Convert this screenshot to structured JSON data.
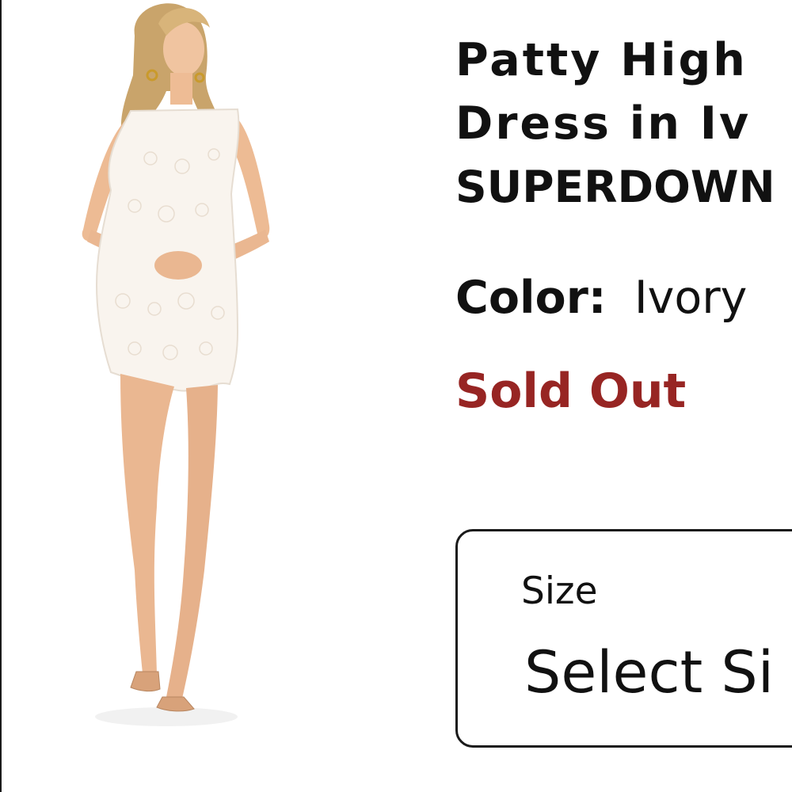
{
  "product": {
    "title_lines": [
      "Patty High",
      "Dress in Iv",
      "SUPERDOWN"
    ],
    "color_label": "Color:",
    "color_value": "Ivory",
    "stock_status": "Sold Out",
    "image_alt": "Model wearing white lace halter mini dress"
  },
  "size_select": {
    "label": "Size",
    "value": "Select Si"
  },
  "colors": {
    "sold_out": "#972523",
    "text": "#111111",
    "border": "#1a1a1a"
  }
}
